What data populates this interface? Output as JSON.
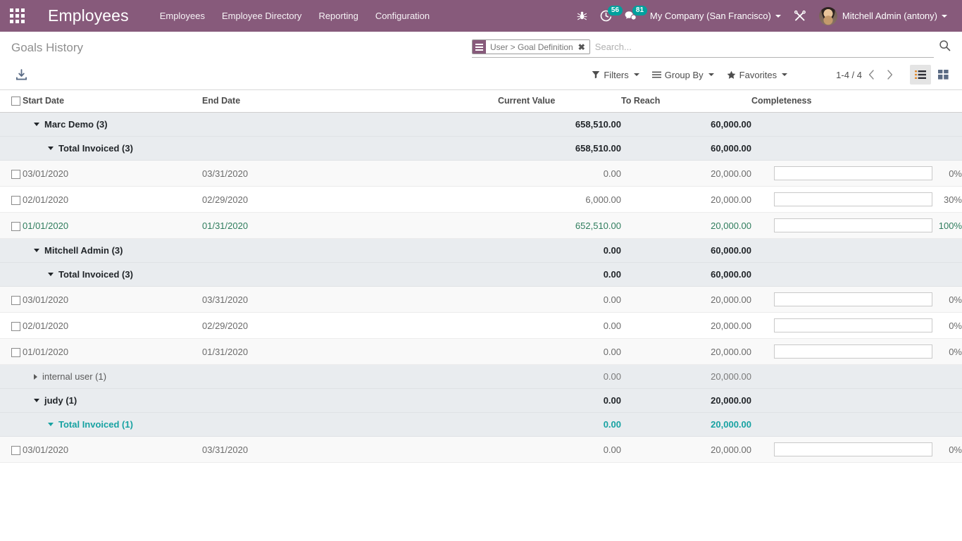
{
  "navbar": {
    "apps_icon": "apps-grid-icon",
    "brand": "Employees",
    "menu": [
      {
        "label": "Employees"
      },
      {
        "label": "Employee Directory"
      },
      {
        "label": "Reporting"
      },
      {
        "label": "Configuration"
      }
    ],
    "debug_icon": "bug-icon",
    "activities": {
      "icon": "clock-icon",
      "count": "56"
    },
    "messages": {
      "icon": "chat-bubble-icon",
      "count": "81"
    },
    "company": "My Company (San Francisco)",
    "tools_icon": "wrench-screwdriver-icon",
    "user": "Mitchell Admin (antony)",
    "avatar": "user-avatar"
  },
  "control_panel": {
    "breadcrumb": "Goals History",
    "export_icon": "download-export-icon",
    "search": {
      "facet_icon": "group-by-bars-icon",
      "facet_label": "User > Goal Definition",
      "facet_close": "✖",
      "placeholder": "Search...",
      "value": "",
      "search_icon": "magnifier-icon"
    },
    "filters_label": "Filters",
    "filters_icon": "funnel-icon",
    "groupby_label": "Group By",
    "groupby_icon": "bars-icon",
    "favorites_label": "Favorites",
    "favorites_icon": "star-icon",
    "pager": "1-4 / 4",
    "prev_icon": "chevron-left-icon",
    "next_icon": "chevron-right-icon",
    "view_list_icon": "list-view-icon",
    "view_kanban_icon": "kanban-view-icon",
    "active_view": "list"
  },
  "table": {
    "columns": {
      "start_date": "Start Date",
      "end_date": "End Date",
      "current_value": "Current Value",
      "to_reach": "To Reach",
      "completeness": "Completeness"
    },
    "rows": [
      {
        "kind": "group",
        "level": 1,
        "state": "expanded",
        "label": "Marc Demo (3)",
        "current_value": "658,510.00",
        "to_reach": "60,000.00"
      },
      {
        "kind": "group",
        "level": 2,
        "state": "expanded",
        "label": "Total Invoiced (3)",
        "current_value": "658,510.00",
        "to_reach": "60,000.00"
      },
      {
        "kind": "record",
        "striped": true,
        "done": false,
        "start_date": "03/01/2020",
        "end_date": "03/31/2020",
        "current_value": "0.00",
        "to_reach": "20,000.00",
        "percent": "0%",
        "progress": 0
      },
      {
        "kind": "record",
        "striped": false,
        "done": false,
        "start_date": "02/01/2020",
        "end_date": "02/29/2020",
        "current_value": "6,000.00",
        "to_reach": "20,000.00",
        "percent": "30%",
        "progress": 30
      },
      {
        "kind": "record",
        "striped": true,
        "done": true,
        "start_date": "01/01/2020",
        "end_date": "01/31/2020",
        "current_value": "652,510.00",
        "to_reach": "20,000.00",
        "percent": "100%",
        "progress": 100
      },
      {
        "kind": "group",
        "level": 1,
        "state": "expanded",
        "label": "Mitchell Admin (3)",
        "current_value": "0.00",
        "to_reach": "60,000.00"
      },
      {
        "kind": "group",
        "level": 2,
        "state": "expanded",
        "label": "Total Invoiced (3)",
        "current_value": "0.00",
        "to_reach": "60,000.00"
      },
      {
        "kind": "record",
        "striped": true,
        "done": false,
        "start_date": "03/01/2020",
        "end_date": "03/31/2020",
        "current_value": "0.00",
        "to_reach": "20,000.00",
        "percent": "0%",
        "progress": 0
      },
      {
        "kind": "record",
        "striped": false,
        "done": false,
        "start_date": "02/01/2020",
        "end_date": "02/29/2020",
        "current_value": "0.00",
        "to_reach": "20,000.00",
        "percent": "0%",
        "progress": 0
      },
      {
        "kind": "record",
        "striped": true,
        "done": false,
        "start_date": "01/01/2020",
        "end_date": "01/31/2020",
        "current_value": "0.00",
        "to_reach": "20,000.00",
        "percent": "0%",
        "progress": 0
      },
      {
        "kind": "group",
        "level": 1,
        "state": "collapsed",
        "label": "internal user (1)",
        "current_value": "0.00",
        "to_reach": "20,000.00"
      },
      {
        "kind": "group",
        "level": 1,
        "state": "expanded",
        "label": "judy (1)",
        "current_value": "0.00",
        "to_reach": "20,000.00"
      },
      {
        "kind": "group",
        "level": 2,
        "state": "expanded",
        "hovered": true,
        "label": "Total Invoiced (1)",
        "current_value": "0.00",
        "to_reach": "20,000.00"
      },
      {
        "kind": "record",
        "striped": true,
        "done": false,
        "start_date": "03/01/2020",
        "end_date": "03/31/2020",
        "current_value": "0.00",
        "to_reach": "20,000.00",
        "percent": "0%",
        "progress": 0
      }
    ]
  },
  "colors": {
    "brand_purple": "#875a7b",
    "accent_teal": "#00A09D",
    "progress_teal": "#25a0a0",
    "done_green": "#2f7d5d",
    "group_bg": "#e9ecef"
  }
}
